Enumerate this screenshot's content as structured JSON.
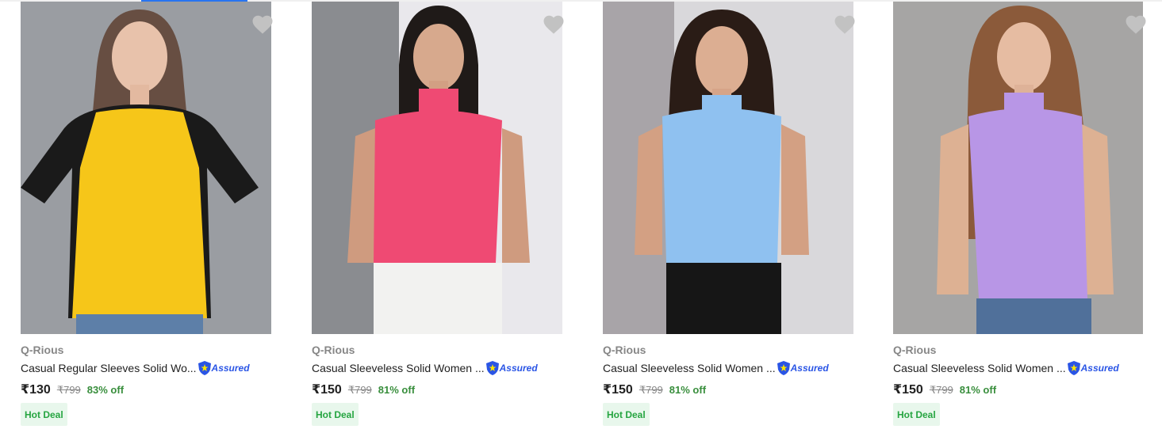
{
  "products": [
    {
      "brand": "Q-Rious",
      "title": "Casual Regular Sleeves Solid Wo...",
      "assured": "Assured",
      "price": "₹130",
      "mrp": "₹799",
      "discount": "83% off",
      "badge": "Hot Deal",
      "top_color": "#f6c619",
      "sleeve_color": "#1a1a1a",
      "bg_color": "#9fa3a8",
      "bottom_color": "#5d7fa8"
    },
    {
      "brand": "Q-Rious",
      "title": "Casual Sleeveless Solid Women ...",
      "assured": "Assured",
      "price": "₹150",
      "mrp": "₹799",
      "discount": "81% off",
      "badge": "Hot Deal",
      "top_color": "#ef4a73",
      "sleeve_color": "#ef4a73",
      "bg_color": "#8a8c90",
      "bottom_color": "#f2f2f0"
    },
    {
      "brand": "Q-Rious",
      "title": "Casual Sleeveless Solid Women ...",
      "assured": "Assured",
      "price": "₹150",
      "mrp": "₹799",
      "discount": "81% off",
      "badge": "Hot Deal",
      "top_color": "#8fc1f0",
      "sleeve_color": "#8fc1f0",
      "bg_color": "#d9d8db",
      "bottom_color": "#161616"
    },
    {
      "brand": "Q-Rious",
      "title": "Casual Sleeveless Solid Women ...",
      "assured": "Assured",
      "price": "₹150",
      "mrp": "₹799",
      "discount": "81% off",
      "badge": "Hot Deal",
      "top_color": "#b896e6",
      "sleeve_color": "#b896e6",
      "bg_color": "#a6a5a4",
      "bottom_color": "#50709a"
    }
  ],
  "icons": {
    "wishlist": "heart-icon",
    "assured": "shield-icon"
  }
}
